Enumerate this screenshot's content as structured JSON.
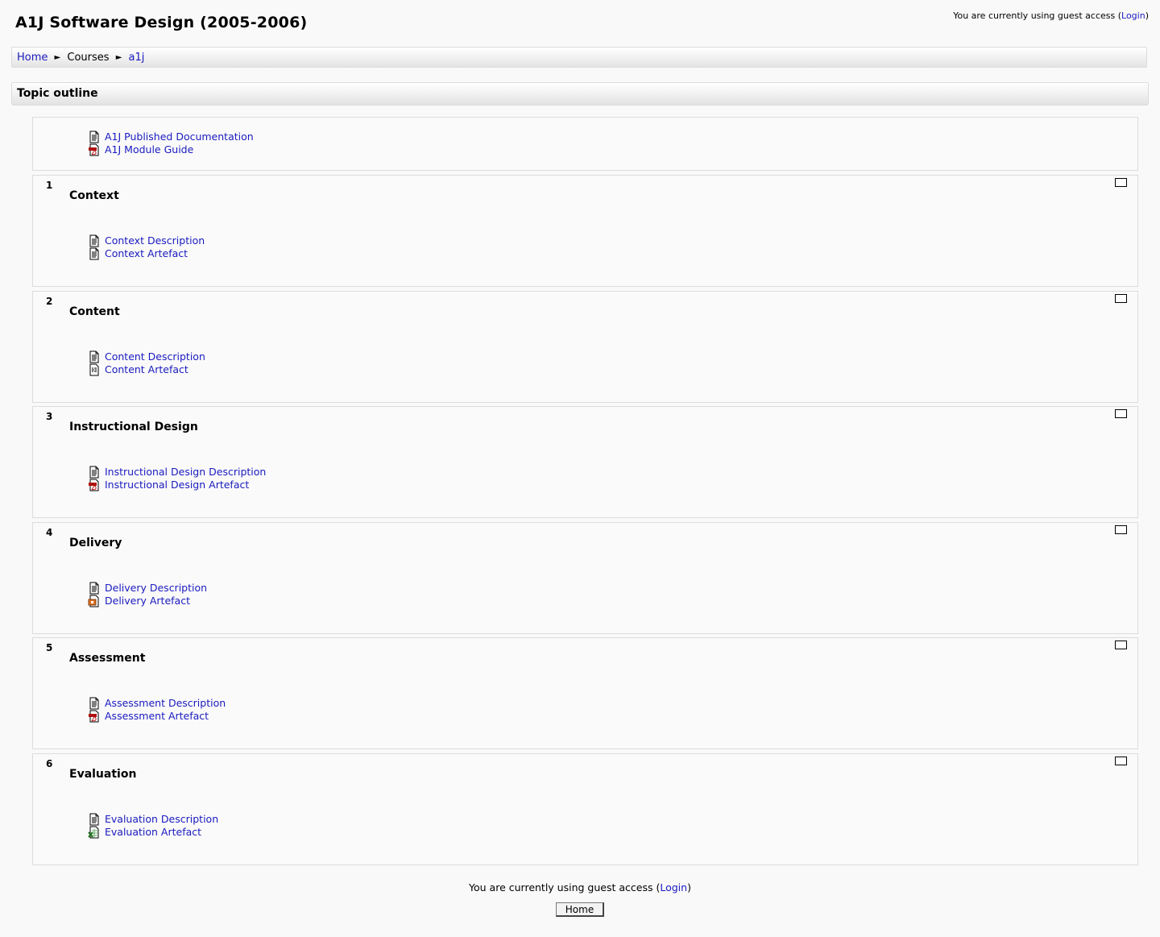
{
  "header": {
    "title": "A1J Software Design (2005-2006)",
    "login_prefix": "You are currently using guest access (",
    "login_link": "Login",
    "login_suffix": ")"
  },
  "breadcrumb": {
    "home": "Home",
    "separator": "►",
    "courses": "Courses",
    "current": "a1j"
  },
  "outline": {
    "heading": "Topic outline",
    "intro_activities": [
      {
        "label": "A1J Published Documentation",
        "icon": "document-icon"
      },
      {
        "label": "A1J Module Guide",
        "icon": "pdf-icon"
      }
    ],
    "sections": [
      {
        "number": "1",
        "title": "Context",
        "activities": [
          {
            "label": "Context Description",
            "icon": "document-icon"
          },
          {
            "label": "Context Artefact",
            "icon": "document-icon"
          }
        ]
      },
      {
        "number": "2",
        "title": "Content",
        "activities": [
          {
            "label": "Content Description",
            "icon": "document-icon"
          },
          {
            "label": "Content Artefact",
            "icon": "text-file-icon"
          }
        ]
      },
      {
        "number": "3",
        "title": "Instructional Design",
        "activities": [
          {
            "label": "Instructional Design Description",
            "icon": "document-icon"
          },
          {
            "label": "Instructional Design Artefact",
            "icon": "pdf-icon"
          }
        ]
      },
      {
        "number": "4",
        "title": "Delivery",
        "activities": [
          {
            "label": "Delivery Description",
            "icon": "document-icon"
          },
          {
            "label": "Delivery Artefact",
            "icon": "powerpoint-icon"
          }
        ]
      },
      {
        "number": "5",
        "title": "Assessment",
        "activities": [
          {
            "label": "Assessment Description",
            "icon": "document-icon"
          },
          {
            "label": "Assessment Artefact",
            "icon": "pdf-icon"
          }
        ]
      },
      {
        "number": "6",
        "title": "Evaluation",
        "activities": [
          {
            "label": "Evaluation Description",
            "icon": "document-icon"
          },
          {
            "label": "Evaluation Artefact",
            "icon": "spreadsheet-icon"
          }
        ]
      }
    ]
  },
  "footer": {
    "login_prefix": "You are currently using guest access (",
    "login_link": "Login",
    "login_suffix": ")",
    "home_button": "Home"
  },
  "colors": {
    "link": "#1a1abf",
    "background": "#f9f9f9",
    "border": "#dcdcdc"
  }
}
